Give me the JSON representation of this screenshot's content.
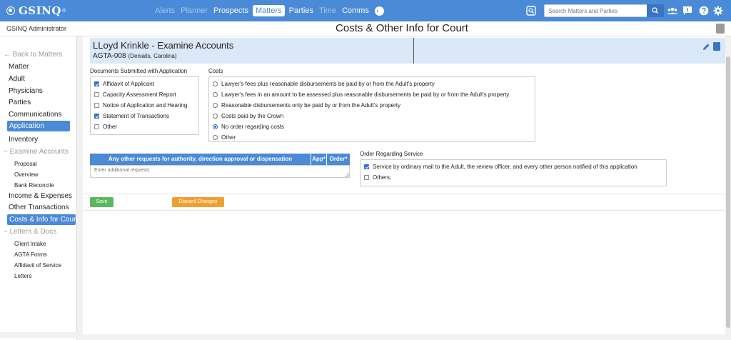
{
  "app": {
    "brand": "GSINQ",
    "brand_mark": "®"
  },
  "nav": {
    "items": [
      {
        "label": "Alerts",
        "state": "dim"
      },
      {
        "label": "Planner",
        "state": "dim"
      },
      {
        "label": "Prospects",
        "state": "on"
      },
      {
        "label": "Matters",
        "state": "active"
      },
      {
        "label": "Parties",
        "state": "on"
      },
      {
        "label": "Time",
        "state": "dim"
      },
      {
        "label": "Comms",
        "state": "on"
      }
    ],
    "search_placeholder": "Search Matters and Parties"
  },
  "header": {
    "user": "GSINQ Administrator",
    "title": "Costs & Other Info for Court"
  },
  "sidebar": {
    "back": "← Back to Matters",
    "items": [
      {
        "label": "Matter"
      },
      {
        "label": "Adult"
      },
      {
        "label": "Physicians"
      },
      {
        "label": "Parties"
      },
      {
        "label": "Communications"
      },
      {
        "label": "Application"
      },
      {
        "label": "Inventory"
      },
      {
        "label": "− Examine Accounts"
      },
      {
        "label": "Proposal"
      },
      {
        "label": "Overview"
      },
      {
        "label": "Bank Reconcile"
      },
      {
        "label": "Income & Expenses"
      },
      {
        "label": "Other Transactions"
      },
      {
        "label": "Costs & Info for Court"
      },
      {
        "label": "− Letters & Docs"
      },
      {
        "label": "Client Intake"
      },
      {
        "label": "AGTA Forms"
      },
      {
        "label": "Affidavit of Service"
      },
      {
        "label": "Letters"
      }
    ]
  },
  "matter": {
    "title": "LLoyd Krinkle - Examine Accounts",
    "number": "AGTA-008",
    "parties": "(Denialis, Carolina)"
  },
  "documents": {
    "label": "Documents Submitted with Application",
    "items": [
      {
        "label": "Affidavit of Applicant",
        "checked": true
      },
      {
        "label": "Capacity Assessment Report",
        "checked": false
      },
      {
        "label": "Notice of Application and Hearing",
        "checked": false
      },
      {
        "label": "Statement of Transactions",
        "checked": true
      },
      {
        "label": "Other",
        "checked": false
      }
    ]
  },
  "costs": {
    "label": "Costs",
    "options": [
      {
        "label": "Lawyer's fees plus reasonable disbursements be paid by or from the Adult's property",
        "selected": false
      },
      {
        "label": "Lawyer's fees in an amount to be assessed plus reasonable disbursements be paid by or from the Adult's property",
        "selected": false
      },
      {
        "label": "Reasonable disbursements only be paid by or from the Adult's property",
        "selected": false
      },
      {
        "label": "Costs paid by the Crown",
        "selected": false
      },
      {
        "label": "No order regarding costs",
        "selected": true
      },
      {
        "label": "Other",
        "selected": false
      }
    ]
  },
  "requests": {
    "col_request": "Any other requests for authority, direction approval or dispensation",
    "col_app": "App*",
    "col_order": "Order*",
    "placeholder": "Enter additional requests"
  },
  "service": {
    "label": "Order Regarding Service",
    "items": [
      {
        "label": "Service by ordinary mail to the Adult, the review officer, and every other person notified of this application",
        "checked": true
      },
      {
        "label": "Others:",
        "checked": false
      }
    ]
  },
  "actions": {
    "save": "Save",
    "discard": "Discard Changes"
  },
  "colors": {
    "brand": "#4a8ad6",
    "save": "#5cb85c",
    "discard": "#f0a030",
    "header_band": "#dbe8f7"
  }
}
